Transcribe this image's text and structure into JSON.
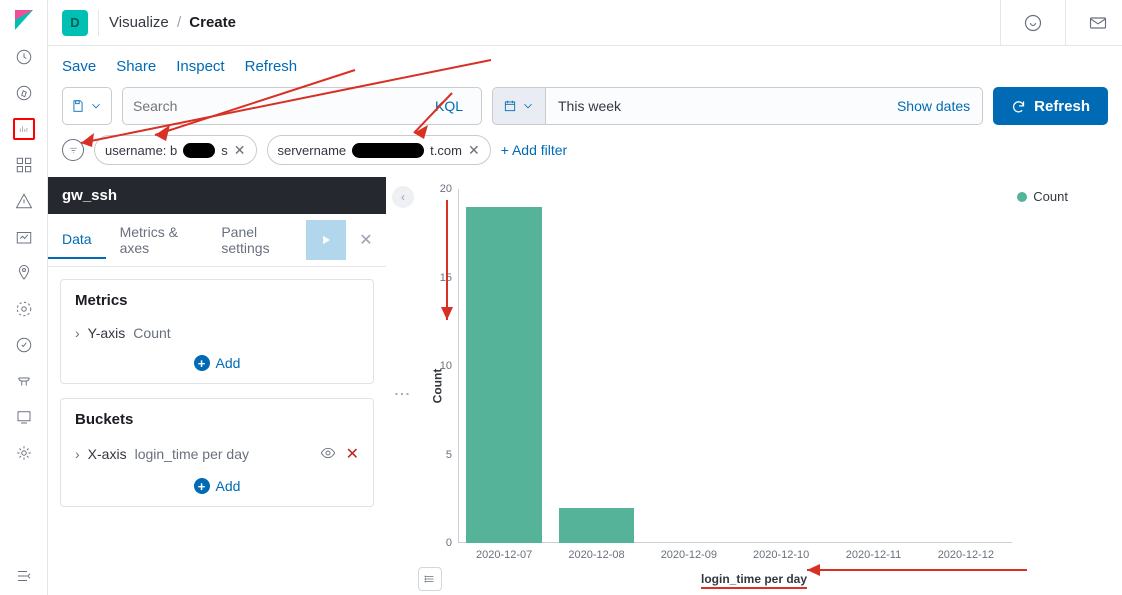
{
  "user_initial": "D",
  "breadcrumb": {
    "parent": "Visualize",
    "current": "Create"
  },
  "actions": {
    "save": "Save",
    "share": "Share",
    "inspect": "Inspect",
    "refresh": "Refresh"
  },
  "search": {
    "placeholder": "Search",
    "kql": "KQL"
  },
  "date": {
    "value": "This week",
    "show_dates": "Show dates"
  },
  "refresh_button": "Refresh",
  "filters": {
    "f1_prefix": "username: b",
    "f1_suffix": "s",
    "f2_prefix": "servername",
    "f2_suffix": "t.com",
    "add": "+ Add filter"
  },
  "viz_title": "gw_ssh",
  "tabs": {
    "data": "Data",
    "metrics_axes": "Metrics & axes",
    "panel": "Panel settings"
  },
  "metrics": {
    "heading": "Metrics",
    "row_label": "Y-axis",
    "row_value": "Count",
    "add": "Add"
  },
  "buckets": {
    "heading": "Buckets",
    "row_label": "X-axis",
    "row_value": "login_time per day",
    "add": "Add"
  },
  "legend": {
    "label": "Count"
  },
  "chart_data": {
    "type": "bar",
    "title": "",
    "xlabel": "login_time per day",
    "ylabel": "Count",
    "ylim": [
      0,
      20
    ],
    "yticks": [
      0,
      5,
      10,
      15,
      20
    ],
    "categories": [
      "2020-12-07",
      "2020-12-08",
      "2020-12-09",
      "2020-12-10",
      "2020-12-11",
      "2020-12-12"
    ],
    "values": [
      19,
      2,
      0,
      0,
      0,
      0
    ],
    "series_name": "Count",
    "color": "#54b399"
  }
}
